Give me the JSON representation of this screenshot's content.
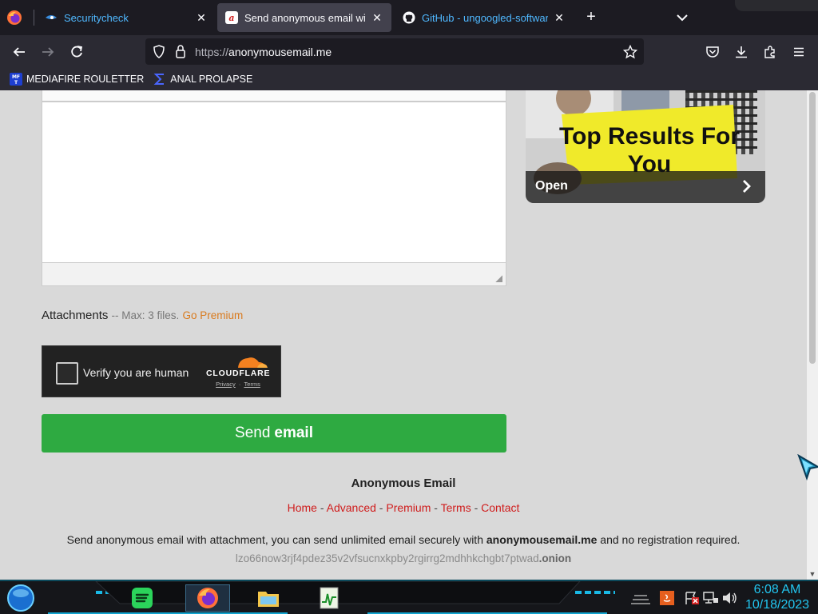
{
  "tabs": [
    {
      "title": "Securitycheck",
      "icon": "shield-swirl-icon",
      "active": false
    },
    {
      "title": "Send anonymous email with the",
      "icon": "anonymousemail-logo-icon",
      "active": true
    },
    {
      "title": "GitHub - ungoogled-software/",
      "icon": "github-icon",
      "active": false
    }
  ],
  "nav": {
    "url_protocol": "https://",
    "url_host": "anonymousemail.me"
  },
  "bookmarks": [
    {
      "label": "MEDIAFIRE ROULETTER",
      "icon": "mft-icon"
    },
    {
      "label": "ANAL PROLAPSE",
      "icon": "sigma-icon"
    }
  ],
  "ad": {
    "headline": "Top Results For You",
    "cta": "Open"
  },
  "form": {
    "attachments_label": "Attachments",
    "attachments_meta": "-- Max: 3 files.",
    "go_premium": "Go Premium",
    "captcha_label": "Verify you are human",
    "captcha_brand": "CLOUDFLARE",
    "captcha_privacy": "Privacy",
    "captcha_terms": "Terms",
    "send_prefix": "Send",
    "send_bold": "email"
  },
  "footer": {
    "title": "Anonymous Email",
    "links": [
      "Home",
      "Advanced",
      "Premium",
      "Terms",
      "Contact"
    ],
    "desc_before": "Send anonymous email with attachment, you can send unlimited email securely with",
    "desc_brand": "anonymousemail.me",
    "desc_after": "and no registration required.",
    "onion_prefix": "lzo66now3rjf4pdez35v2vfsucnxkpby2rgirrg2mdhhkchgbt7ptwad",
    "onion_suffix": ".onion"
  },
  "taskbar": {
    "time": "6:08 AM",
    "date": "10/18/2023"
  },
  "colors": {
    "send_button": "#2eaa41",
    "footer_link": "#d01d1d",
    "premium_link": "#d97a1d",
    "clock": "#22c6f0"
  }
}
